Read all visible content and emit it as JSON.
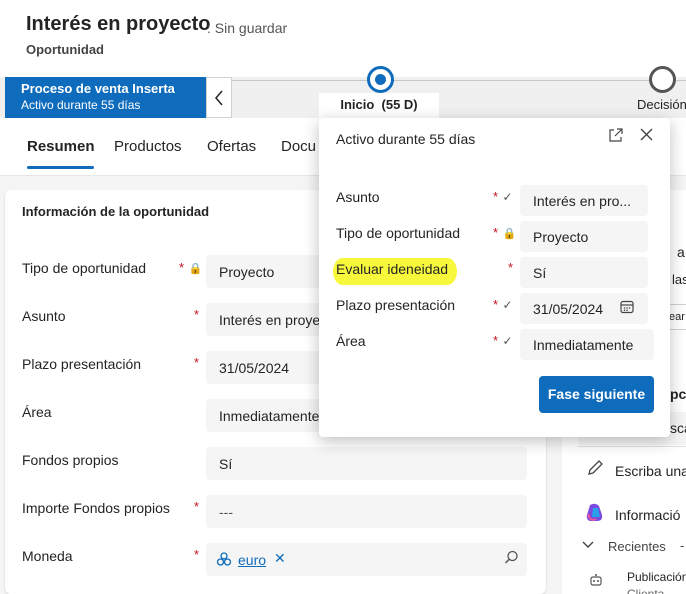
{
  "header": {
    "title": "Interés en proyecto",
    "save_status": ": Sin guardar",
    "entity": "Oportunidad"
  },
  "bpf": {
    "process_name": "Proceso de venta Inserta",
    "process_duration": "Activo durante 55 días",
    "collapse_icon": "chevron-left-icon",
    "stage1_label": "Inicio  (55 D)",
    "stage2_label": "Decisión"
  },
  "tabs": [
    "Resumen",
    "Productos",
    "Ofertas",
    "Docu"
  ],
  "section": {
    "title": "Información de la oportunidad",
    "fields": [
      {
        "label": "Tipo de oportunidad",
        "required": "*",
        "value": "Proyecto",
        "locked": true
      },
      {
        "label": "Asunto",
        "required": "*",
        "value": "Interés en proye"
      },
      {
        "label": "Plazo presentación",
        "required": "*",
        "value": "31/05/2024"
      },
      {
        "label": "Área",
        "required": "",
        "value": "Inmediatamente"
      },
      {
        "label": "Fondos propios",
        "required": "",
        "value": "Sí"
      },
      {
        "label": "Importe Fondos propios",
        "required": "*",
        "value": "---"
      },
      {
        "label": "Moneda",
        "required": "*",
        "value": "euro"
      }
    ]
  },
  "right_panel": {
    "partial_texts": [
      "a",
      "las",
      "ear",
      "pc",
      "sca"
    ],
    "write_label": "Escriba una",
    "copilot_label": "Informació",
    "recent_label": "Recientes",
    "recent_dash": "-",
    "pub_label1": "Publicación",
    "pub_label2": "Clienta"
  },
  "flyout": {
    "header": "Activo durante 55 días",
    "fields": [
      {
        "label": "Asunto",
        "required": "*",
        "status": "✓",
        "value": "Interés en pro..."
      },
      {
        "label": "Tipo de oportunidad",
        "required": "*",
        "status": "lock",
        "value": "Proyecto"
      },
      {
        "label": "Evaluar ideneidad",
        "required": "*",
        "status": "",
        "value": "Sí"
      },
      {
        "label": "Plazo presentación",
        "required": "*",
        "status": "✓",
        "value": "31/05/2024"
      },
      {
        "label": "Área",
        "required": "*",
        "status": "✓",
        "value": "Inmediatamente"
      }
    ],
    "next_button": "Fase siguiente",
    "highlight_color": "#f7f73c"
  },
  "colors": {
    "accent": "#0f6cbd",
    "required": "#c50f1f"
  }
}
